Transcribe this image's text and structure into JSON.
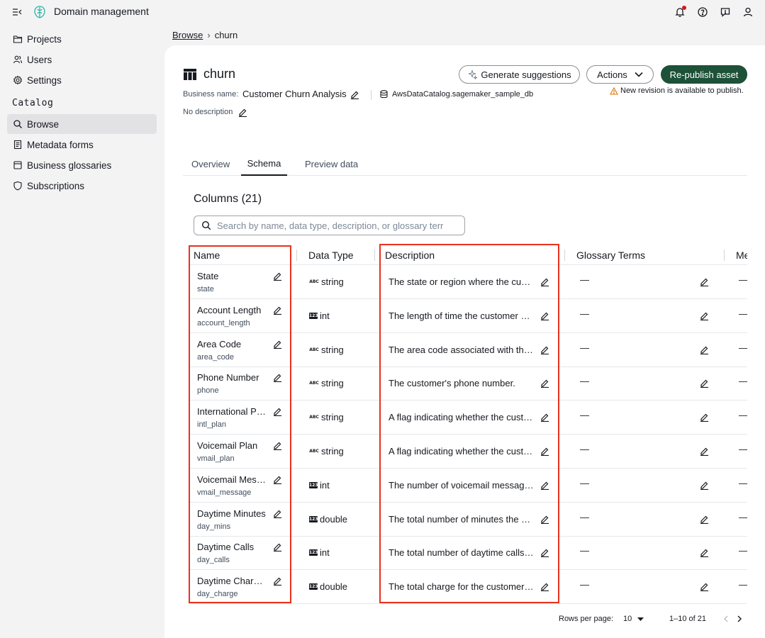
{
  "app": {
    "title": "Domain management"
  },
  "sidebar": {
    "items": [
      {
        "label": "Projects",
        "icon": "folder-icon"
      },
      {
        "label": "Users",
        "icon": "users-icon"
      },
      {
        "label": "Settings",
        "icon": "gear-icon"
      }
    ],
    "section_label": "Catalog",
    "catalog_items": [
      {
        "label": "Browse",
        "icon": "search-icon",
        "active": true
      },
      {
        "label": "Metadata forms",
        "icon": "form-icon"
      },
      {
        "label": "Business glossaries",
        "icon": "book-icon"
      },
      {
        "label": "Subscriptions",
        "icon": "shield-icon"
      }
    ]
  },
  "breadcrumb": {
    "parent": "Browse",
    "separator": "›",
    "current": "churn"
  },
  "asset": {
    "title": "churn",
    "business_name_label": "Business name:",
    "business_name": "Customer Churn Analysis",
    "database": "AwsDataCatalog.sagemaker_sample_db",
    "description": "No description"
  },
  "actions": {
    "generate": "Generate suggestions",
    "actions": "Actions",
    "republish": "Re-publish asset",
    "warning": "New revision is available to publish."
  },
  "tabs": [
    {
      "label": "Overview",
      "active": false
    },
    {
      "label": "Schema",
      "active": true
    },
    {
      "label": "Preview data",
      "active": false
    }
  ],
  "columns_heading": "Columns (21)",
  "search": {
    "placeholder": "Search by name, data type, description, or glossary terr",
    "value": ""
  },
  "table": {
    "headers": {
      "name": "Name",
      "type": "Data Type",
      "description": "Description",
      "glossary": "Glossary Terms",
      "more": "Me"
    },
    "empty_value": "—",
    "rows": [
      {
        "name": "State",
        "key": "state",
        "type": "string",
        "description": "The state or region where the customer lives."
      },
      {
        "name": "Account Length",
        "key": "account_length",
        "type": "int",
        "description": "The length of time the customer has had the account."
      },
      {
        "name": "Area Code",
        "key": "area_code",
        "type": "string",
        "description": "The area code associated with the customer's phone number."
      },
      {
        "name": "Phone Number",
        "key": "phone",
        "type": "string",
        "description": "The customer's phone number."
      },
      {
        "name": "International Plan",
        "key": "intl_plan",
        "type": "string",
        "description": "A flag indicating whether the customer has an international plan."
      },
      {
        "name": "Voicemail Plan",
        "key": "vmail_plan",
        "type": "string",
        "description": "A flag indicating whether the customer has a voicemail plan."
      },
      {
        "name": "Voicemail Messages",
        "key": "vmail_message",
        "type": "int",
        "description": "The number of voicemail messages the customer has."
      },
      {
        "name": "Daytime Minutes",
        "key": "day_mins",
        "type": "double",
        "description": "The total number of minutes the customer used during the day."
      },
      {
        "name": "Daytime Calls",
        "key": "day_calls",
        "type": "int",
        "description": "The total number of daytime calls made by the customer."
      },
      {
        "name": "Daytime Charges",
        "key": "day_charge",
        "type": "double",
        "description": "The total charge for the customer's daytime usage."
      }
    ]
  },
  "pagination": {
    "rows_label": "Rows per page:",
    "rows_value": "10",
    "range": "1–10 of 21"
  },
  "colors": {
    "primary": "#1d5138",
    "highlight": "#e8321d",
    "warning": "#d97706",
    "notification": "#d91515"
  }
}
